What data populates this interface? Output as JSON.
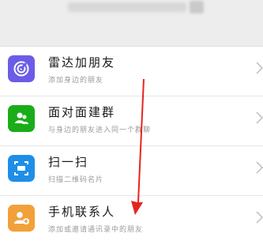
{
  "header": {
    "search_placeholder": ""
  },
  "items": [
    {
      "title": "雷达加朋友",
      "subtitle": "添加身边的朋友",
      "icon": "radar-icon",
      "color": "#6b5ce7"
    },
    {
      "title": "面对面建群",
      "subtitle": "与身边的朋友进入同一个群聊",
      "icon": "face-to-face-icon",
      "color": "#1aad19"
    },
    {
      "title": "扫一扫",
      "subtitle": "扫描二维码名片",
      "icon": "scan-icon",
      "color": "#1f8ee8"
    },
    {
      "title": "手机联系人",
      "subtitle": "添加或邀请通讯录中的朋友",
      "icon": "contacts-icon",
      "color": "#f2a03a"
    }
  ],
  "annotation": {
    "arrow_color": "#e8231f"
  }
}
